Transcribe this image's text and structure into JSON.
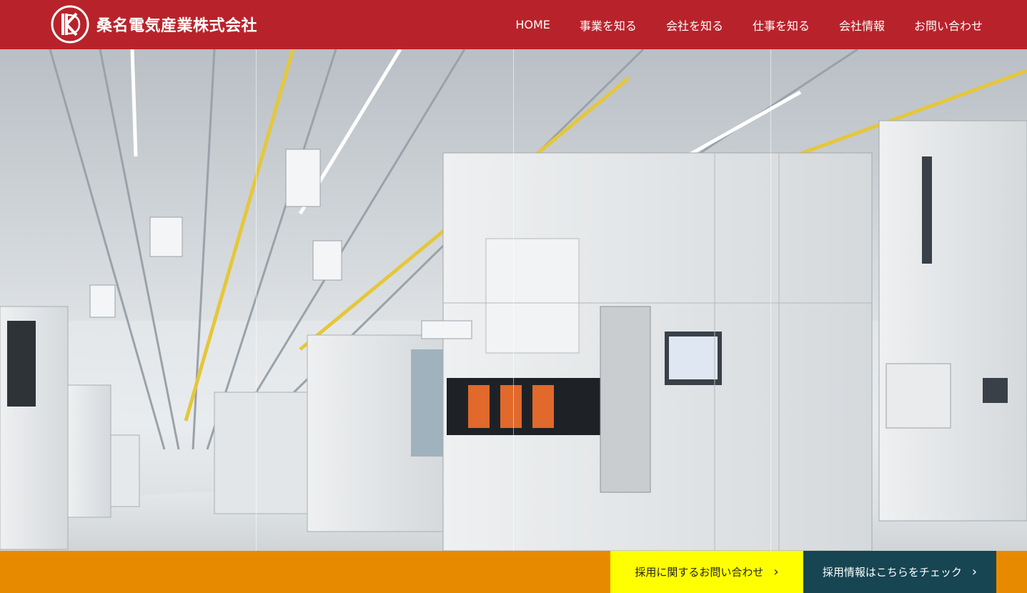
{
  "header": {
    "company_name": "桑名電気産業株式会社",
    "brand_color": "#b8232b"
  },
  "nav": {
    "items": [
      {
        "label": "HOME"
      },
      {
        "label": "事業を知る"
      },
      {
        "label": "会社を知る"
      },
      {
        "label": "仕事を知る"
      },
      {
        "label": "会社情報"
      },
      {
        "label": "お問い合わせ"
      }
    ]
  },
  "hero": {
    "image_subject": "semiconductor cleanroom factory interior"
  },
  "cta": {
    "inquiry_label": "採用に関するお問い合わせ",
    "recruit_label": "採用情報はこちらをチェック",
    "inquiry_color": "#ffff00",
    "recruit_color": "#174552",
    "bar_color": "#e88a00"
  }
}
